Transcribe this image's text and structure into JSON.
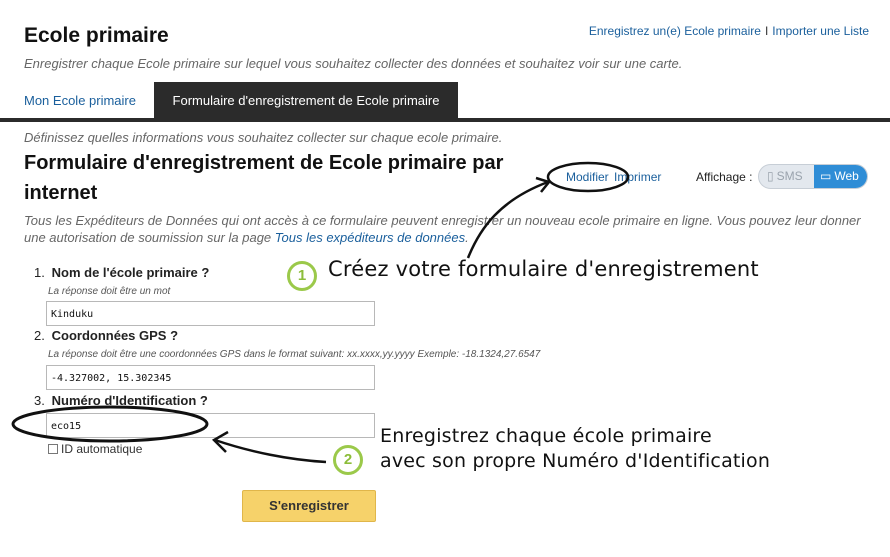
{
  "header": {
    "title": "Ecole primaire",
    "subtitle": "Enregistrer chaque Ecole primaire sur lequel vous souhaitez collecter des données et souhaitez voir sur une carte.",
    "links": {
      "register": "Enregistrez un(e) Ecole primaire",
      "separator": "I",
      "import": "Importer une Liste"
    }
  },
  "tabs": [
    {
      "label": "Mon Ecole primaire",
      "active": false
    },
    {
      "label": "Formulaire d'enregistrement de Ecole primaire",
      "active": true
    }
  ],
  "intro": "Définissez quelles informations vous souhaitez collecter sur chaque ecole primaire.",
  "form_title": "Formulaire d'enregistrement de Ecole primaire par internet",
  "actions": {
    "modify": "Modifier",
    "print": "Imprimer"
  },
  "display": {
    "label": "Affichage :",
    "options": [
      {
        "label": "SMS",
        "selected": false
      },
      {
        "label": "Web",
        "selected": true
      }
    ]
  },
  "description": {
    "text": "Tous les Expéditeurs de Données qui ont accès à ce formulaire peuvent enregistrer un nouveau ecole primaire en ligne. Vous pouvez leur donner une autorisation de soumission sur la page ",
    "link": "Tous les expéditeurs de données",
    "end": "."
  },
  "questions": [
    {
      "number": "1.",
      "label": "Nom de l'école primaire ?",
      "hint": "La réponse doit être un mot",
      "value": "Kinduku"
    },
    {
      "number": "2.",
      "label": "Coordonnées GPS ?",
      "hint": "La réponse doit être une coordonnées GPS dans le format suivant: xx.xxxx,yy.yyyy Exemple: -18.1324,27.6547",
      "value": "-4.327002, 15.302345"
    },
    {
      "number": "3.",
      "label": "Numéro d'Identification ?",
      "value": "eco15"
    }
  ],
  "auto_id": {
    "label": "ID automatique",
    "checked": false
  },
  "submit_label": "S'enregistrer",
  "annotations": [
    {
      "badge": "1",
      "text": "Créez votre formulaire d'enregistrement"
    },
    {
      "badge": "2",
      "line1": "Enregistrez chaque école primaire",
      "line2": "avec son propre Numéro d'Identification"
    }
  ],
  "colors": {
    "link": "#1a5f9c",
    "tab_active": "#2b2b2b",
    "web_toggle": "#2f8dd6",
    "submit": "#f6d26a",
    "badge": "#9bc94a"
  }
}
